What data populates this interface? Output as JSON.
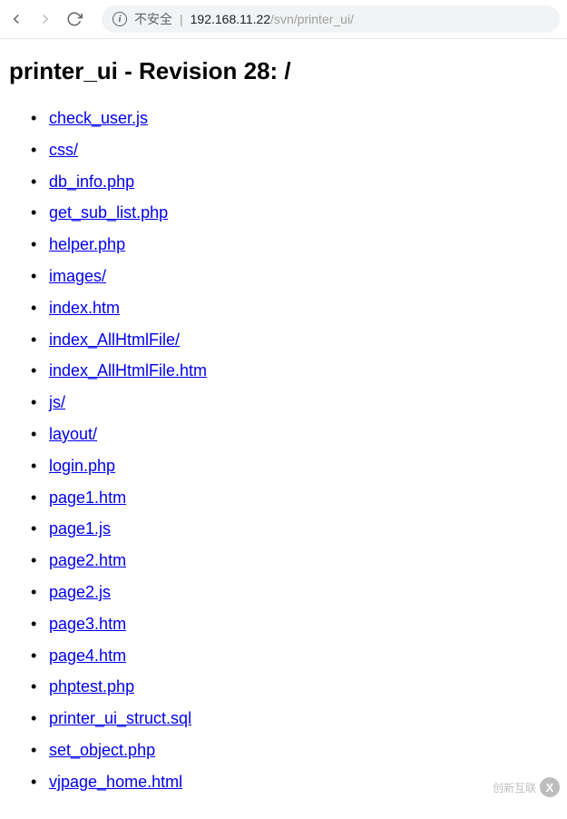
{
  "toolbar": {
    "info_symbol": "i",
    "security_label": "不安全",
    "url_host": "192.168.11.22",
    "url_path": "/svn/printer_ui/"
  },
  "page": {
    "title": "printer_ui - Revision 28: /"
  },
  "files": [
    "check_user.js",
    "css/",
    "db_info.php",
    "get_sub_list.php",
    "helper.php",
    "images/",
    "index.htm",
    "index_AllHtmlFile/",
    "index_AllHtmlFile.htm",
    "js/",
    "layout/",
    "login.php",
    "page1.htm",
    "page1.js",
    "page2.htm",
    "page2.js",
    "page3.htm",
    "page4.htm",
    "phptest.php",
    "printer_ui_struct.sql",
    "set_object.php",
    "vjpage_home.html"
  ],
  "watermark": {
    "text": "创新互联",
    "badge": "X"
  }
}
